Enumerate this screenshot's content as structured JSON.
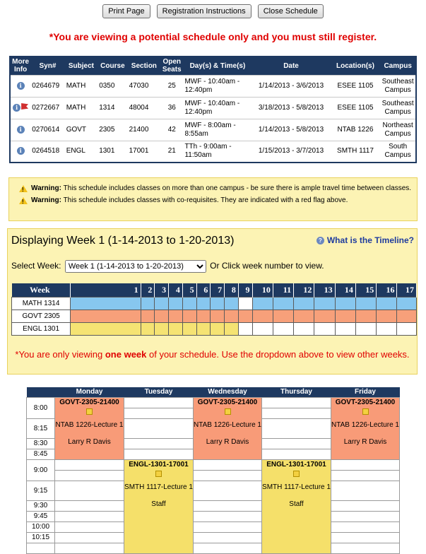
{
  "buttons": {
    "print": "Print Page",
    "instructions": "Registration Instructions",
    "close": "Close Schedule"
  },
  "notice": "*You are viewing a potential schedule only and you must still register.",
  "course_table": {
    "headers": {
      "more": "More Info",
      "syn": "Syn#",
      "subject": "Subject",
      "course": "Course",
      "section": "Section",
      "seats": "Open Seats",
      "days": "Day(s) & Time(s)",
      "date": "Date",
      "location": "Location(s)",
      "campus": "Campus"
    },
    "rows": [
      {
        "syn": "0264679",
        "subject": "MATH",
        "course": "0350",
        "section": "47030",
        "seats": "25",
        "days": "MWF - 10:40am - 12:40pm",
        "date": "1/14/2013 - 3/6/2013",
        "location": "ESEE 1105",
        "campus": "Southeast Campus"
      },
      {
        "syn": "0272667",
        "subject": "MATH",
        "course": "1314",
        "section": "48004",
        "seats": "36",
        "days": "MWF - 10:40am - 12:40pm",
        "date": "3/18/2013 - 5/8/2013",
        "location": "ESEE 1105",
        "campus": "Southeast Campus"
      },
      {
        "syn": "0270614",
        "subject": "GOVT",
        "course": "2305",
        "section": "21400",
        "seats": "42",
        "days": "MWF - 8:00am - 8:55am",
        "date": "1/14/2013 - 5/8/2013",
        "location": "NTAB 1226",
        "campus": "Northeast Campus"
      },
      {
        "syn": "0264518",
        "subject": "ENGL",
        "course": "1301",
        "section": "17001",
        "seats": "21",
        "days": "TTh - 9:00am - 11:50am",
        "date": "1/15/2013 - 3/7/2013",
        "location": "SMTH 1117",
        "campus": "South Campus"
      }
    ]
  },
  "warnings": {
    "label": "Warning:",
    "w1": "This schedule includes classes on more than one campus - be sure there is ample travel time between classes.",
    "w2": "This schedule includes classes with co-requisites. They are indicated with a red flag above."
  },
  "timeline": {
    "displaying": "Displaying Week 1 (1-14-2013 to 1-20-2013)",
    "what_link": "What is the Timeline?",
    "select_label": "Select Week:",
    "selected_week": "Week 1 (1-14-2013 to 1-20-2013)",
    "or_click": "Or Click week number to view.",
    "week_header": "Week",
    "weeks": [
      "1",
      "2",
      "3",
      "4",
      "5",
      "6",
      "7",
      "8",
      "9",
      "10",
      "11",
      "12",
      "13",
      "14",
      "15",
      "16",
      "17"
    ],
    "rows": [
      "MATH 1314",
      "GOVT 2305",
      "ENGL 1301"
    ],
    "only_pre": "*You are only viewing ",
    "only_bold": "one week",
    "only_post": " of your schedule. Use the dropdown above to view other weeks."
  },
  "calendar": {
    "days": [
      "Monday",
      "Tuesday",
      "Wednesday",
      "Thursday",
      "Friday"
    ],
    "times": [
      "8:00",
      "",
      "8:15",
      "8:30",
      "8:45",
      "9:00",
      "",
      "9:15",
      "9:30",
      "9:45",
      "10:00",
      "10:15"
    ],
    "govt": {
      "title": "GOVT-2305-21400",
      "room": "NTAB 1226-Lecture 1",
      "instructor": "Larry R Davis"
    },
    "engl": {
      "title": "ENGL-1301-17001",
      "room": "SMTH 1117-Lecture 1",
      "instructor": "Staff"
    }
  },
  "colors": {
    "header": "#1e3960",
    "math": "#87c7ef",
    "govt": "#f7a07a",
    "engl": "#f5e373",
    "warning_bg": "#fcf3b4"
  }
}
